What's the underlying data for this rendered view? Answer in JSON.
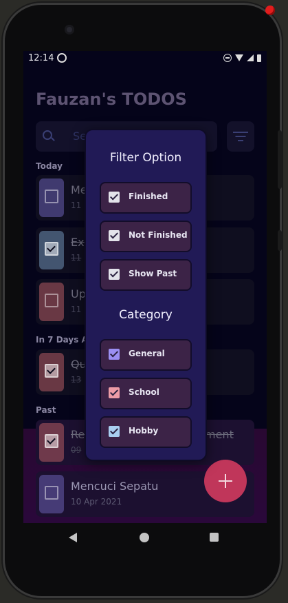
{
  "status_bar": {
    "time": "12:14"
  },
  "app": {
    "title": "Fauzan's TODOS",
    "search_placeholder": "Se"
  },
  "sections": {
    "today": "Today",
    "next7": "In 7 Days Al",
    "past": "Past"
  },
  "todos": [
    {
      "title": "Me",
      "date": "11",
      "checked": false,
      "done": false,
      "color": "#6a5fb0"
    },
    {
      "title": "Ex",
      "date": "11",
      "checked": true,
      "done": true,
      "color": "#6f8fb2"
    },
    {
      "title": "Up",
      "date": "11",
      "checked": false,
      "done": false,
      "color": "#b55b63"
    },
    {
      "title": "Qu",
      "date": "13",
      "checked": true,
      "done": true,
      "color": "#b55b63"
    },
    {
      "title": "Re",
      "title_tail": "ment",
      "date": "09",
      "checked": true,
      "done": true,
      "color": "#b55b63"
    },
    {
      "title": "Mencuci Sepatu",
      "date": "10 Apr 2021",
      "checked": false,
      "done": false,
      "color": "#6a5fb0"
    }
  ],
  "dialog": {
    "filter_heading": "Filter Option",
    "filter_options": [
      {
        "label": "Finished",
        "checked": true,
        "color": "#e3e3ea"
      },
      {
        "label": "Not Finished",
        "checked": true,
        "color": "#e3e3ea"
      },
      {
        "label": "Show Past",
        "checked": true,
        "color": "#e3e3ea"
      }
    ],
    "category_heading": "Category",
    "categories": [
      {
        "label": "General",
        "checked": true,
        "color": "#9b8ff2"
      },
      {
        "label": "School",
        "checked": true,
        "color": "#ec9ca6"
      },
      {
        "label": "Hobby",
        "checked": true,
        "color": "#a9cff0"
      }
    ]
  },
  "fab": {
    "icon": "plus-icon"
  }
}
